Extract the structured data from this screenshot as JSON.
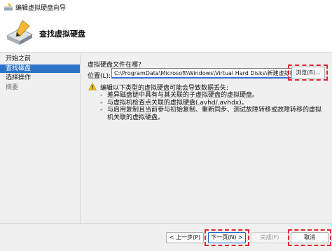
{
  "window": {
    "title": "编辑虚拟硬盘向导",
    "icon": "wizard-icon"
  },
  "header": {
    "title": "查找虚拟硬盘",
    "icon": "disk-pen-icon"
  },
  "sidebar": {
    "items": [
      {
        "label": "开始之前",
        "state": "normal"
      },
      {
        "label": "查找磁盘",
        "state": "active"
      },
      {
        "label": "选择操作",
        "state": "normal"
      },
      {
        "label": "摘要",
        "state": "disabled"
      }
    ]
  },
  "main": {
    "question": "虚拟硬盘文件在哪?",
    "location_label": "位置(L):",
    "location_value": "C:\\ProgramData\\Microsoft\\Windows\\Virtual Hard Disks\\新建虚拟机.vhdx",
    "browse_label": "浏览(B)...",
    "warning_title": "编辑以下类型的虚拟硬盘可能会导致数据丢失:",
    "warning_items": [
      "差异磁盘链中具有与其关联的子虚拟硬盘的虚拟硬盘。",
      "与虚拟机检查点关联的虚拟硬盘(.avhd/.avhdx)。",
      "与启用复制且当前参与初始复制、重新同步、测试故障转移或故障转移的虚拟机关联的虚拟硬盘。"
    ]
  },
  "buttons": {
    "prev": "< 上一步(P)",
    "next": "下一页(N) >",
    "finish": "完成(F)",
    "cancel": "取消"
  },
  "colors": {
    "accent": "#2d73c7",
    "highlight": "#e0282e",
    "warning": "#f2c01e"
  }
}
